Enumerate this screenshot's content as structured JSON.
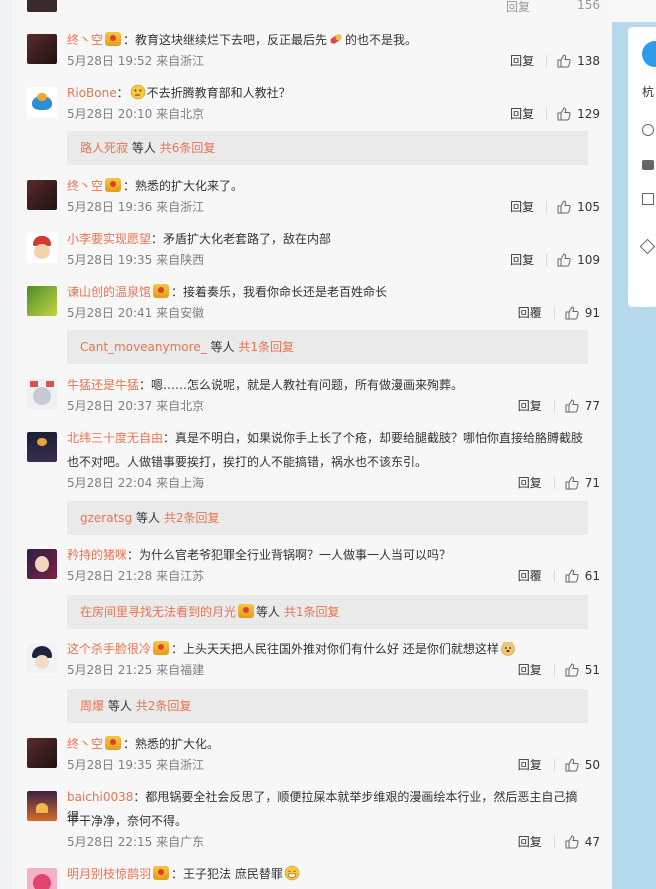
{
  "top_partial": {
    "reply_label": "回复",
    "like_count": "156"
  },
  "comments": [
    {
      "user": "终丶空",
      "badge": true,
      "text": "教育这块继续烂下去吧，反正最后先",
      "emoji": "pill",
      "text_after": "的也不是我。",
      "time": "5月28日 19:52",
      "location": "来自浙江",
      "reply_label": "回复",
      "likes": "138"
    },
    {
      "user": "RioBone",
      "badge": false,
      "emoji_before": "thinking-face",
      "text": "不去折腾教育部和人教社？",
      "time": "5月28日 20:10",
      "location": "来自北京",
      "reply_label": "回复",
      "likes": "129",
      "subreply": {
        "link": "路人死寂",
        "suffix": "等人",
        "count_link": "共6条回复"
      }
    },
    {
      "user": "终丶空",
      "badge": true,
      "text": "熟悉的扩大化来了。",
      "time": "5月28日 19:36",
      "location": "来自浙江",
      "reply_label": "回复",
      "likes": "105"
    },
    {
      "user": "小李要实现愿望",
      "badge": false,
      "text": "矛盾扩大化老套路了，敌在内部",
      "time": "5月28日 19:35",
      "location": "来自陕西",
      "reply_label": "回复",
      "likes": "109"
    },
    {
      "user": "谏山创的温泉馆",
      "badge": true,
      "text": "接着奏乐，我看你命长还是老百姓命长",
      "time": "5月28日 20:41",
      "location": "来自安徽",
      "reply_label": "回覆",
      "likes": "91",
      "subreply": {
        "link": "Cant_moveanymore_",
        "suffix": "等人",
        "count_link": "共1条回复"
      }
    },
    {
      "user": "牛猛还是牛猛",
      "badge": false,
      "text": "嗯……怎么说呢，就是人教社有问题，所有做漫画来殉葬。",
      "time": "5月28日 20:37",
      "location": "来自北京",
      "reply_label": "回复",
      "likes": "77"
    },
    {
      "user": "北纬三十度无自由",
      "badge": false,
      "text": "真是不明白，如果说你手上长了个疮，却要给腿截肢？哪怕你直接给胳膊截肢",
      "text_line2": "也不对吧。人做错事要挨打，挨打的人不能搞错，祸水也不该东引。",
      "time": "5月28日 22:04",
      "location": "来自上海",
      "reply_label": "回复",
      "likes": "71",
      "subreply": {
        "link": "gzeratsg",
        "suffix": "等人",
        "count_link": "共2条回复"
      }
    },
    {
      "user": "矜持的猪咪",
      "badge": false,
      "text": "为什么官老爷犯罪全行业背锅啊？一人做事一人当可以吗？",
      "time": "5月28日 21:28",
      "location": "来自江苏",
      "reply_label": "回覆",
      "likes": "61",
      "subreply": {
        "link": "在房间里寻找无法看到的月光",
        "badge": true,
        "suffix": "等人",
        "count_link": "共1条回复"
      }
    },
    {
      "user": "这个杀手脸很冷",
      "badge": true,
      "text": "上头天天把人民往国外推对你们有什么好 还是你们就想这样",
      "emoji": "doge",
      "time": "5月28日 21:25",
      "location": "来自福建",
      "reply_label": "回复",
      "likes": "51",
      "subreply": {
        "link": "周爆",
        "suffix": "等人",
        "count_link": "共2条回复"
      }
    },
    {
      "user": "终丶空",
      "badge": true,
      "text": "熟悉的扩大化。",
      "time": "5月28日 19:35",
      "location": "来自浙江",
      "reply_label": "回复",
      "likes": "50"
    },
    {
      "user": "baichi0038",
      "badge": false,
      "text": "都甩锅要全社会反思了，顺便拉屎本就举步维艰的漫画绘本行业，然后恶主自己摘得",
      "text_line2": "干干净净，奈何不得。",
      "time": "5月28日 22:15",
      "location": "来自广东",
      "reply_label": "回复",
      "likes": "47"
    },
    {
      "user": "明月别枝惊鹊羽",
      "badge": true,
      "text": "王子犯法 庶民替罪",
      "emoji": "grin"
    }
  ],
  "colors": {
    "username": "#eb7350",
    "meta": "#808080",
    "subreply_bg": "#eaeaea",
    "panel_bg": "#f7f7f7",
    "side_blue": "#b7d9ee"
  },
  "right_panel": {
    "label_partial": "杭"
  }
}
